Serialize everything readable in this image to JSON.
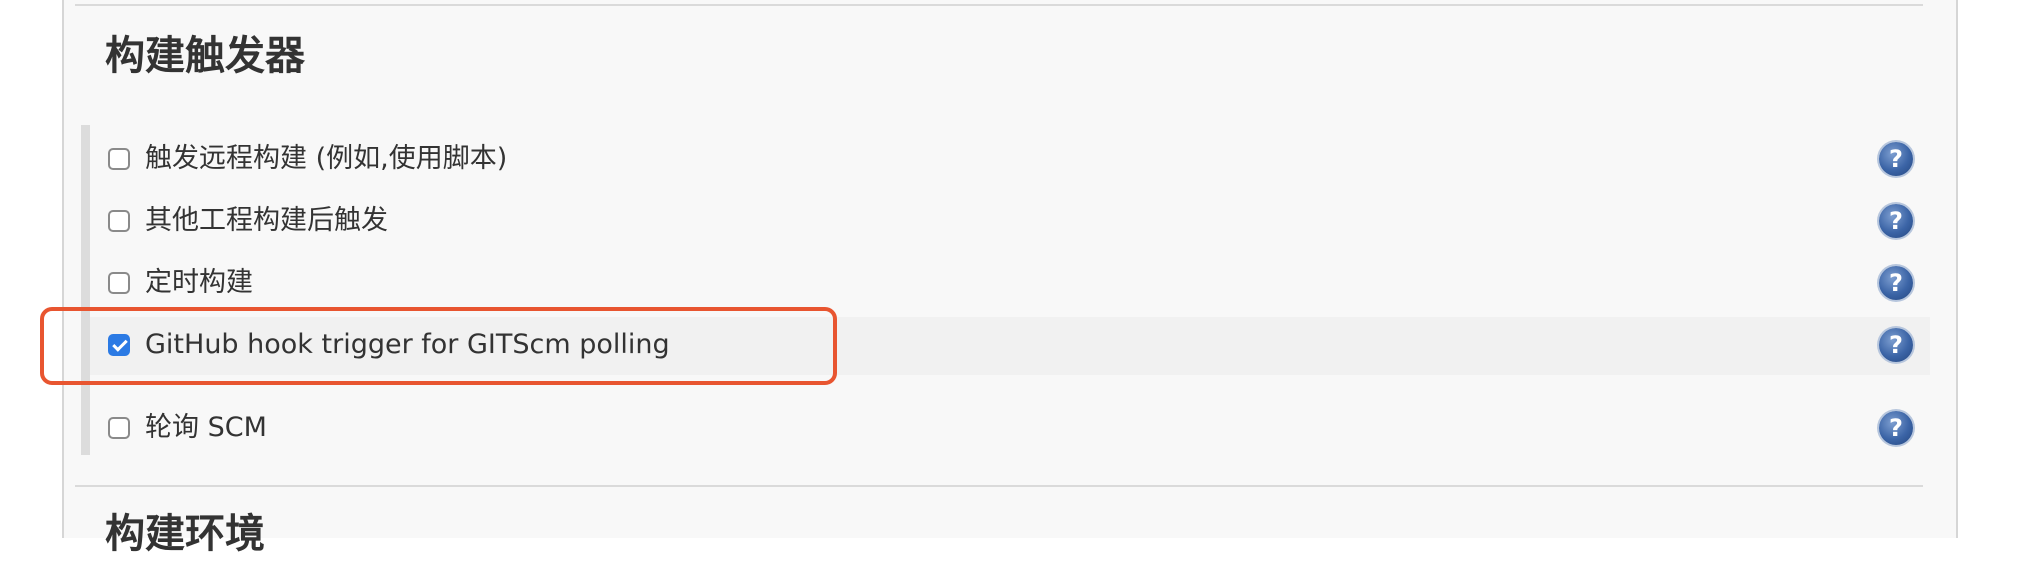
{
  "section": {
    "title": "构建触发器"
  },
  "next_section": {
    "title": "构建环境"
  },
  "options": [
    {
      "label": "触发远程构建 (例如,使用脚本)",
      "checked": false,
      "help_icon": "question-circle-icon"
    },
    {
      "label": "其他工程构建后触发",
      "checked": false,
      "help_icon": "question-circle-icon"
    },
    {
      "label": "定时构建",
      "checked": false,
      "help_icon": "question-circle-icon"
    },
    {
      "label": "GitHub hook trigger for GITScm polling",
      "checked": true,
      "help_icon": "question-circle-icon"
    },
    {
      "label": "轮询 SCM",
      "checked": false,
      "help_icon": "question-circle-icon"
    }
  ],
  "help_glyph": "?",
  "colors": {
    "annotation": "#e85530",
    "checkbox_checked": "#2b7ae4",
    "help_icon": "#3b64a6"
  }
}
